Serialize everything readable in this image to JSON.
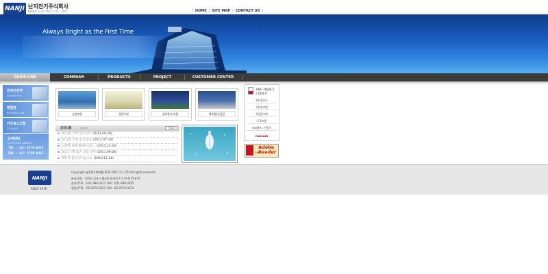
{
  "header": {
    "logo_text": "NANJI",
    "company_name_kr": "난지전기주식회사",
    "company_name_en": "NANJI ELECTRIC CO., LTD.",
    "top_links": [
      "HOME",
      "SITE MAP",
      "CONTACT US"
    ]
  },
  "hero": {
    "slogan": "Always Bright as the First Time"
  },
  "nav": {
    "quick_link": "QUICK LINK",
    "items": [
      "COMPANY",
      "PRODUCTS",
      "PROJECT",
      "CUSTOMER CENTER"
    ]
  },
  "quick_links": [
    {
      "title": "온라인견적",
      "subtitle": "ESTIMATION"
    },
    {
      "title": "영업망",
      "subtitle": "BUSINESS LINE"
    },
    {
      "title": "카다로그신청",
      "subtitle": "CATALOG"
    }
  ],
  "customer_center": {
    "title": "고객센터",
    "subtitle": "CUSTOMER CENTER",
    "tel": "TEL : 02) 2279-0222",
    "fax": "FAX : 02) 2279-0333"
  },
  "products": [
    "산업조명",
    "경관조명",
    "골프장/스키장",
    "체육관/운동장"
  ],
  "notice": {
    "title": "공지사항",
    "subtitle": "Notice",
    "more": "more",
    "items": [
      {
        "text": "2013년 추석 휴무공지",
        "date": "(2012.09.28)"
      },
      {
        "text": "2012년 하계 휴가 실정",
        "date": "(2012.07.24)"
      },
      {
        "text": "11월에 새해 행복하시길...",
        "date": "(2011.12.28)"
      },
      {
        "text": "2011 하계 휴가 일정 공지",
        "date": "(2011.06.08)"
      },
      {
        "text": "새해 복 많이 받으십시오",
        "date": "(2010.12.28)"
      }
    ]
  },
  "pdf_catalog": {
    "title_line1": "PDF 카탈로그",
    "title_line2": "다운로드",
    "items": [
      "포트폴리오",
      "고천장조명",
      "투광등조명",
      "도로조명",
      "HID램프 / 안정기"
    ],
    "brand": "IWASAKI"
  },
  "adobe": {
    "get": "Get",
    "name_line1": "Adobe",
    "name_line2": "Reader"
  },
  "footer": {
    "logo_text": "NANJI",
    "since": "SINCE 1976",
    "copyright": "Copyright @2004 NANJI ELECTRIC CO.,LTD All rights reserved.",
    "address": "본사/공장 : 경기도 김포시 월곶면 갈산리 7-2 (우)415-870",
    "hq_contact": "관리부TEL : 031-999-0222     FAX : 031-999-0555",
    "sales_contact": "영업부TEL : 02-2279-0222     FAX : 02-2279-0333"
  },
  "colors": {
    "brand_blue": "#1b3f8f",
    "nav_dark": "#3b3b3b",
    "quick_link_blue": "#6b9be0",
    "adobe_red": "#c8102e"
  }
}
